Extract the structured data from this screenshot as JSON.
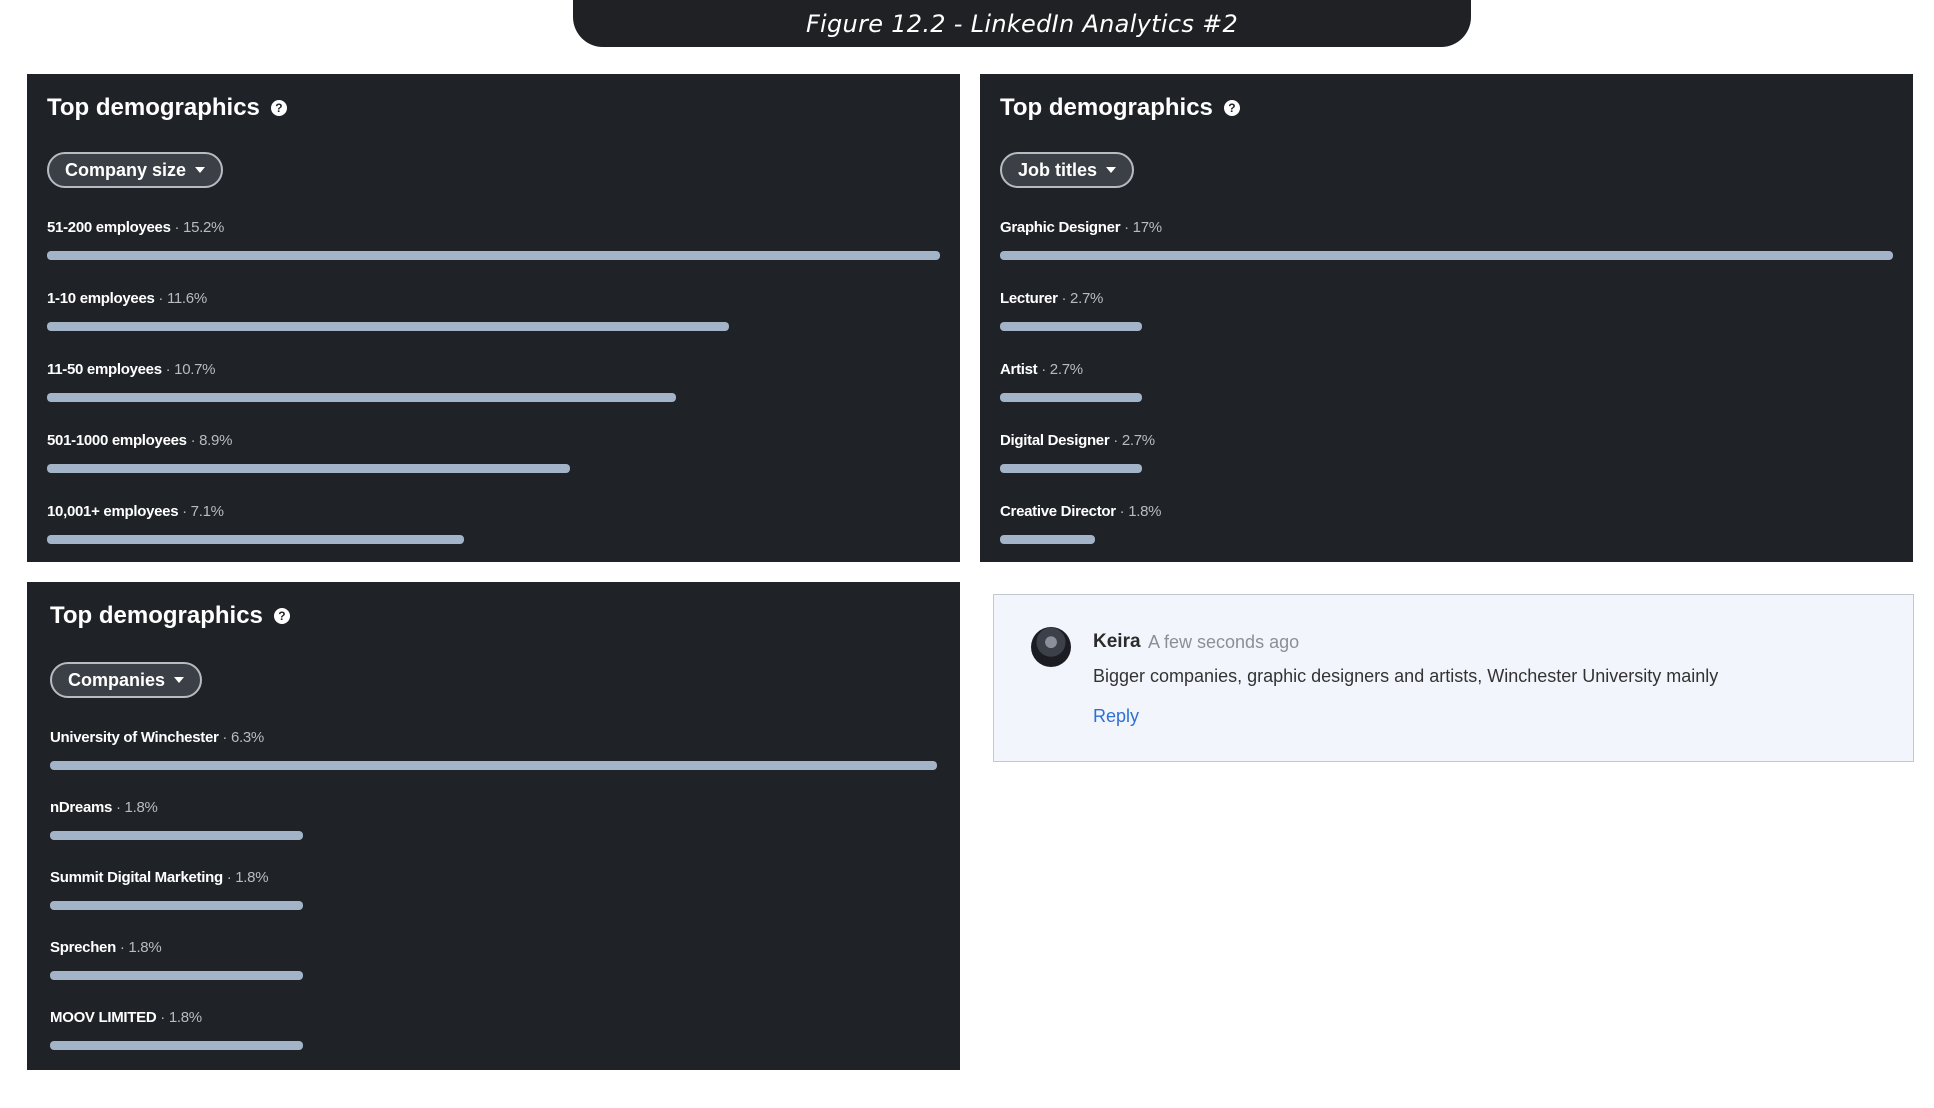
{
  "caption": "Figure 12.2 - LinkedIn Analytics #2",
  "cards": {
    "company": {
      "title": "Top demographics",
      "help_icon": "help-circle-icon",
      "dropdown": "Company size",
      "rows": [
        {
          "name": "51-200 employees",
          "pct": " · 15.2%",
          "value": 15.2
        },
        {
          "name": "1-10 employees",
          "pct": " · 11.6%",
          "value": 11.6
        },
        {
          "name": "11-50 employees",
          "pct": " · 10.7%",
          "value": 10.7
        },
        {
          "name": "501-1000 employees",
          "pct": " · 8.9%",
          "value": 8.9
        },
        {
          "name": "10,001+ employees",
          "pct": " · 7.1%",
          "value": 7.1
        }
      ]
    },
    "jobs": {
      "title": "Top demographics",
      "help_icon": "help-circle-icon",
      "dropdown": "Job titles",
      "rows": [
        {
          "name": "Graphic Designer",
          "pct": " · 17%",
          "value": 17
        },
        {
          "name": "Lecturer",
          "pct": " · 2.7%",
          "value": 2.7
        },
        {
          "name": "Artist",
          "pct": " · 2.7%",
          "value": 2.7
        },
        {
          "name": "Digital Designer",
          "pct": " · 2.7%",
          "value": 2.7
        },
        {
          "name": "Creative Director",
          "pct": " · 1.8%",
          "value": 1.8
        }
      ]
    },
    "companies": {
      "title": "Top demographics",
      "help_icon": "help-circle-icon",
      "dropdown": "Companies",
      "rows": [
        {
          "name": "University of Winchester",
          "pct": " · 6.3%",
          "value": 6.3
        },
        {
          "name": "nDreams",
          "pct": " · 1.8%",
          "value": 1.8
        },
        {
          "name": "Summit Digital Marketing",
          "pct": " · 1.8%",
          "value": 1.8
        },
        {
          "name": "Sprechen",
          "pct": " · 1.8%",
          "value": 1.8
        },
        {
          "name": "MOOV LIMITED",
          "pct": " · 1.8%",
          "value": 1.8
        }
      ]
    }
  },
  "comment": {
    "author": "Keira",
    "time": "A few seconds ago",
    "text": "Bigger companies, graphic designers and artists, Winchester University mainly",
    "reply": "Reply"
  },
  "colors": {
    "card_bg": "#1f2327",
    "bar": "#a3b4c8",
    "link": "#2f6fd6"
  }
}
